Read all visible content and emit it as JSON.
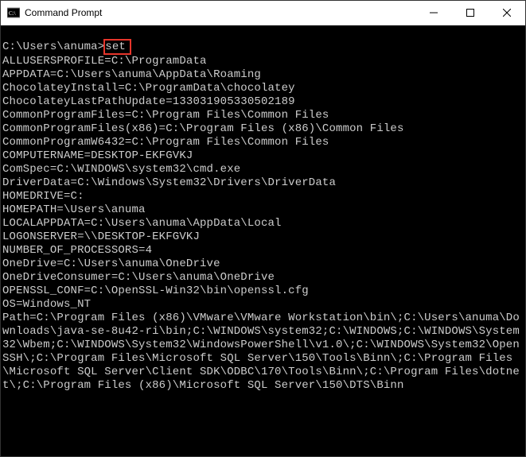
{
  "window": {
    "title": "Command Prompt"
  },
  "prompt": {
    "path": "C:\\Users\\anuma>",
    "command": "set"
  },
  "env": [
    "ALLUSERSPROFILE=C:\\ProgramData",
    "APPDATA=C:\\Users\\anuma\\AppData\\Roaming",
    "ChocolateyInstall=C:\\ProgramData\\chocolatey",
    "ChocolateyLastPathUpdate=133031905330502189",
    "CommonProgramFiles=C:\\Program Files\\Common Files",
    "CommonProgramFiles(x86)=C:\\Program Files (x86)\\Common Files",
    "CommonProgramW6432=C:\\Program Files\\Common Files",
    "COMPUTERNAME=DESKTOP-EKFGVKJ",
    "ComSpec=C:\\WINDOWS\\system32\\cmd.exe",
    "DriverData=C:\\Windows\\System32\\Drivers\\DriverData",
    "HOMEDRIVE=C:",
    "HOMEPATH=\\Users\\anuma",
    "LOCALAPPDATA=C:\\Users\\anuma\\AppData\\Local",
    "LOGONSERVER=\\\\DESKTOP-EKFGVKJ",
    "NUMBER_OF_PROCESSORS=4",
    "OneDrive=C:\\Users\\anuma\\OneDrive",
    "OneDriveConsumer=C:\\Users\\anuma\\OneDrive",
    "OPENSSL_CONF=C:\\OpenSSL-Win32\\bin\\openssl.cfg",
    "OS=Windows_NT",
    "Path=C:\\Program Files (x86)\\VMware\\VMware Workstation\\bin\\;C:\\Users\\anuma\\Downloads\\java-se-8u42-ri\\bin;C:\\WINDOWS\\system32;C:\\WINDOWS;C:\\WINDOWS\\System32\\Wbem;C:\\WINDOWS\\System32\\WindowsPowerShell\\v1.0\\;C:\\WINDOWS\\System32\\OpenSSH\\;C:\\Program Files\\Microsoft SQL Server\\150\\Tools\\Binn\\;C:\\Program Files\\Microsoft SQL Server\\Client SDK\\ODBC\\170\\Tools\\Binn\\;C:\\Program Files\\dotnet\\;C:\\Program Files (x86)\\Microsoft SQL Server\\150\\DTS\\Binn"
  ]
}
